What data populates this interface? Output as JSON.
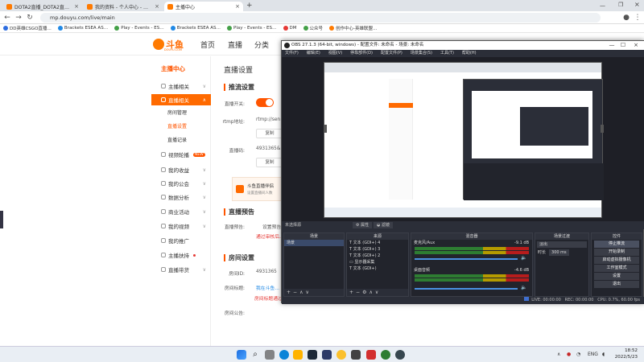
{
  "browser": {
    "tabs": [
      {
        "title": "DOTA2直播_DOTA2直播间视频…",
        "active": false,
        "color": "#ff7a00"
      },
      {
        "title": "我的资料 - 个人中心 - 斗鱼",
        "active": false,
        "color": "#ff7a00"
      },
      {
        "title": "主播中心",
        "active": true,
        "color": "#ff7a00"
      }
    ],
    "url": "mp.douyu.com/live/main",
    "bookmarks": [
      {
        "label": "DD英雄CSGO直播…",
        "color": "#2d6cdf"
      },
      {
        "label": "Brackets ESEA AS…",
        "color": "#1e88e5"
      },
      {
        "label": "Play - Events - ES…",
        "color": "#43a047"
      },
      {
        "label": "Brackets ESEA AS…",
        "color": "#1e88e5"
      },
      {
        "label": "Play - Events - ES…",
        "color": "#43a047"
      },
      {
        "label": "DM",
        "color": "#e53935"
      },
      {
        "label": "公众号",
        "color": "#43a047"
      },
      {
        "label": "创作中心-英雄联盟…",
        "color": "#ff7a00"
      }
    ]
  },
  "douyu": {
    "logo_text": "斗鱼",
    "logo_sub": "DOUYU.COM",
    "nav": [
      "首页",
      "直播",
      "分类"
    ],
    "sidebar": {
      "title": "主播中心",
      "items": [
        {
          "label": "主播相关",
          "active": false
        },
        {
          "label": "直播相关",
          "active": true
        },
        {
          "label": "视频轮播",
          "active": false,
          "badge": "NEW"
        },
        {
          "label": "我的收益",
          "active": false
        },
        {
          "label": "我的公会",
          "active": false
        },
        {
          "label": "数据分析",
          "active": false
        },
        {
          "label": "商业活动",
          "active": false
        },
        {
          "label": "我的视频",
          "active": false
        },
        {
          "label": "我的推广",
          "active": false
        },
        {
          "label": "主播扶持",
          "active": false
        },
        {
          "label": "直播带货",
          "active": false
        }
      ],
      "subitems": [
        {
          "label": "房间管理",
          "on": false
        },
        {
          "label": "直播设置",
          "on": true
        },
        {
          "label": "直播记录",
          "on": false
        }
      ]
    },
    "content": {
      "page_title": "直播设置",
      "stream_section": "推流设置",
      "stream_switch_label": "直播开关:",
      "rtmp_label": "rtmp地址:",
      "rtmp_value": "rtmp://sen",
      "copy_label": "复制",
      "code_label": "直播码:",
      "code_value": "4931365&",
      "promo_title": "斗鱼直播伴侣",
      "promo_sub": "设置直播间人数",
      "preview_section": "直播预告",
      "preview_label": "直播预告:",
      "preview_value": "设置预告",
      "preview_note": "通过审核后…",
      "room_section": "房间设置",
      "room_id_label": "房间ID:",
      "room_id_value": "4931365",
      "room_title_label": "房间标题:",
      "room_title_value": "我在斗鱼…",
      "room_note": "房间标题通过审核后…",
      "room_notice_label": "房间公告:"
    }
  },
  "obs": {
    "title": "OBS 27.1.3 (64-bit, windows) - 配置文件: 未命名 - 场景: 未命名",
    "menu": [
      "文件(F)",
      "编辑(E)",
      "视图(V)",
      "停靠部件(D)",
      "配置文件(P)",
      "场景集合(S)",
      "工具(T)",
      "帮助(H)"
    ],
    "no_source": "未选择源",
    "props_label": "属性",
    "filters_label": "滤镜",
    "docks": {
      "scenes": {
        "header": "场景",
        "items": [
          "场景"
        ]
      },
      "sources": {
        "header": "来源",
        "items": [
          "文本 (GDI+) 4",
          "文本 (GDI+) 3",
          "文本 (GDI+) 2",
          "显示器采集",
          "文本 (GDI+)"
        ]
      },
      "mixer": {
        "header": "混音器",
        "tracks": [
          {
            "name": "麦克风/Aux",
            "db": "-9.1 dB"
          },
          {
            "name": "桌面音频",
            "db": "-4.6 dB"
          }
        ]
      },
      "transitions": {
        "header": "场景过渡",
        "type": "淡出",
        "duration_label": "时长",
        "duration_value": "300 ms"
      },
      "controls": {
        "header": "控件",
        "buttons": [
          "停止推流",
          "开始录制",
          "启动虚拟摄像机",
          "工作室模式",
          "设置",
          "退出"
        ]
      }
    },
    "status": {
      "live": "LIVE: 00:00:00",
      "rec": "REC: 00:00:00",
      "cpu": "CPU: 0.7%, 60.00 fps"
    }
  },
  "taskbar": {
    "time": "18:52",
    "date": "2022/5/23",
    "lang": "ENG"
  }
}
